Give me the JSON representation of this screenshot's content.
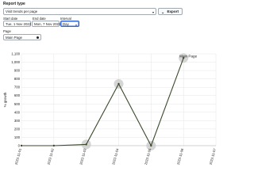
{
  "report": {
    "section_label": "Report type",
    "report_type_value": "Visit trends per page",
    "export_label": "Export"
  },
  "filters": {
    "start_date_label": "Start date",
    "start_date_value": "Tue, 1 Nov 2022",
    "end_date_label": "End date",
    "end_date_value": "Mon, 7 Nov 2022",
    "interval_label": "Interval",
    "interval_value": "Day",
    "page_label": "Page",
    "page_value": "Main Page"
  },
  "chart_data": {
    "type": "line",
    "ylabel": "% growth",
    "x": [
      "2022-11-01",
      "2022-11-02",
      "2022-11-03",
      "2022-11-04",
      "2022-11-05",
      "2022-11-06",
      "2022-11-07"
    ],
    "series": [
      {
        "name": "Main Page",
        "values": [
          0,
          0,
          15,
          740,
          0,
          1050
        ]
      }
    ],
    "ylim": [
      0,
      1100
    ],
    "yticks": [
      0,
      100,
      200,
      300,
      400,
      500,
      600,
      700,
      800,
      900,
      1000,
      1100
    ],
    "ytick_labels": [
      "0",
      "100",
      "200",
      "300",
      "400",
      "500",
      "600",
      "700",
      "800",
      "900",
      "1,000",
      "1,100"
    ],
    "highlighted_points": [
      "2022-11-03",
      "2022-11-04",
      "2022-11-05",
      "2022-11-06"
    ],
    "grid": true,
    "colors": {
      "line": "#3b4a2c",
      "highlight": "#c8c8c8",
      "grid": "#e6e6e6"
    }
  }
}
